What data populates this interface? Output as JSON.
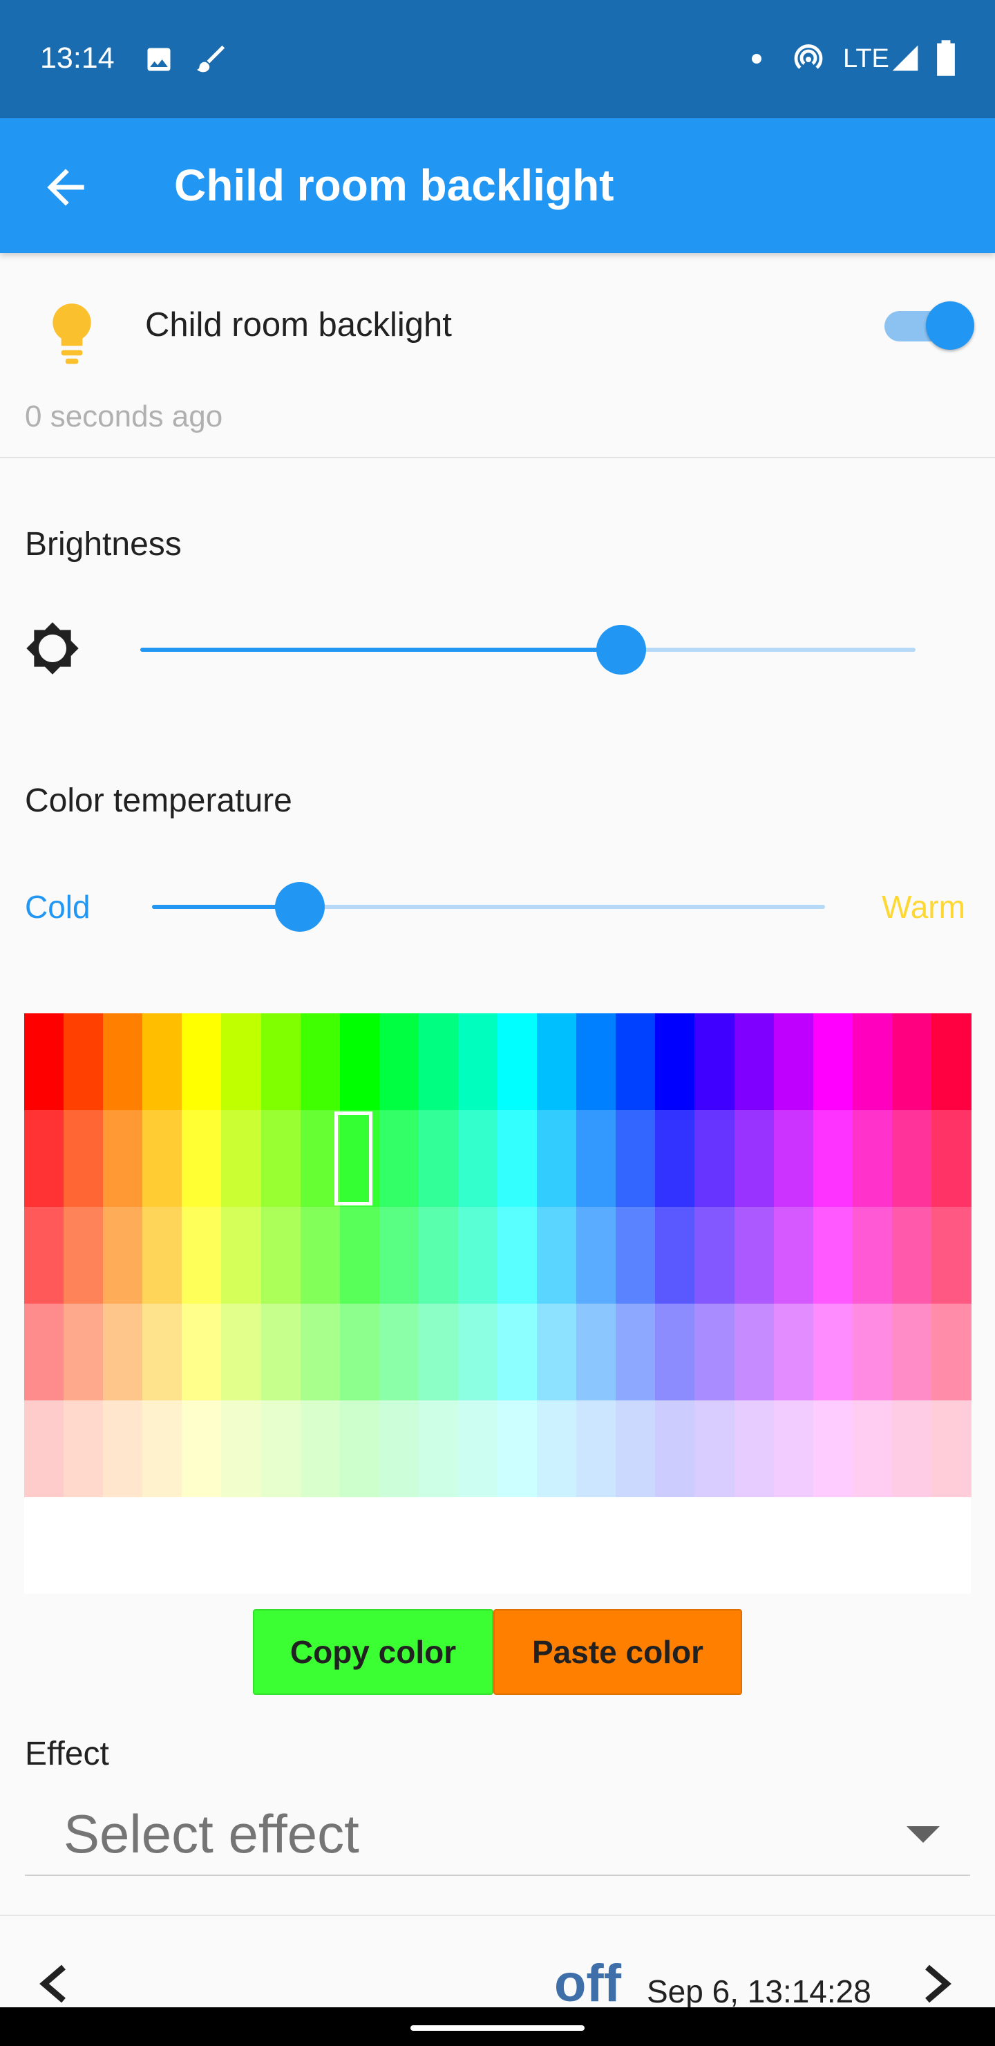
{
  "status_bar": {
    "time": "13:14",
    "network": "LTE"
  },
  "app_bar": {
    "title": "Child room backlight",
    "back_icon": "arrow-back-icon"
  },
  "device": {
    "name": "Child room backlight",
    "last_seen": "0 seconds ago",
    "power_on": true,
    "icon": "lightbulb-icon",
    "icon_color": "#fbc02d"
  },
  "brightness": {
    "label": "Brightness",
    "value_fraction": 0.62,
    "icon": "brightness-icon"
  },
  "color_temperature": {
    "label": "Color temperature",
    "cold_label": "Cold",
    "warm_label": "Warm",
    "value_fraction": 0.22
  },
  "palette": {
    "columns": [
      "#ff0000",
      "#ff4000",
      "#ff8000",
      "#ffbf00",
      "#ffff00",
      "#bfff00",
      "#80ff00",
      "#40ff00",
      "#00ff00",
      "#00ff40",
      "#00ff80",
      "#00ffbf",
      "#00ffff",
      "#00bfff",
      "#0080ff",
      "#0040ff",
      "#0000ff",
      "#4000ff",
      "#8000ff",
      "#bf00ff",
      "#ff00ff",
      "#ff00bf",
      "#ff0080",
      "#ff0040"
    ],
    "row_tints": [
      0,
      0.2,
      0.35,
      0.55,
      0.8
    ],
    "selected": {
      "row": 1,
      "column": 8
    }
  },
  "buttons": {
    "copy": "Copy color",
    "paste": "Paste color",
    "copy_color": "#3cff33",
    "paste_color": "#ff7f00"
  },
  "effect": {
    "label": "Effect",
    "placeholder": "Select effect"
  },
  "history": {
    "state": "off",
    "timestamp": "Sep 6, 13:14:28"
  }
}
